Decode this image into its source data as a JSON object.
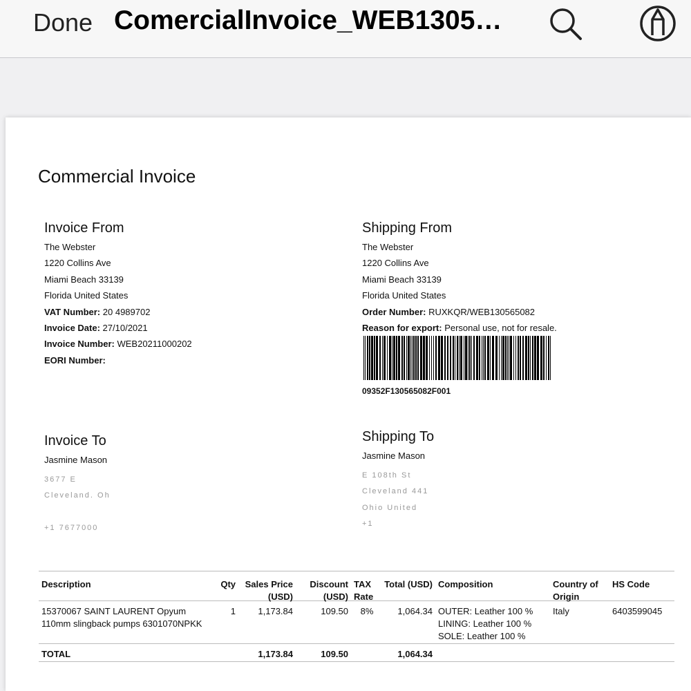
{
  "toolbar": {
    "done_label": "Done",
    "title": "ComercialInvoice_WEB1305…",
    "search_icon": "search-icon",
    "markup_icon": "markup-pen-icon"
  },
  "document": {
    "title": "Commercial Invoice",
    "invoice_from": {
      "heading": "Invoice From",
      "lines": [
        "The Webster",
        "1220 Collins Ave",
        "Miami Beach 33139",
        "Florida United States"
      ],
      "vat_label": "VAT Number:",
      "vat_value": "20 4989702",
      "date_label": "Invoice Date:",
      "date_value": "27/10/2021",
      "number_label": "Invoice Number:",
      "number_value": "WEB20211000202",
      "eori_label": "EORI Number:"
    },
    "shipping_from": {
      "heading": "Shipping From",
      "lines": [
        "The Webster",
        "1220 Collins Ave",
        "Miami Beach 33139",
        "Florida United States"
      ],
      "order_label": "Order Number:",
      "order_value": "RUXKQR/WEB130565082",
      "reason_label": "Reason for export:",
      "reason_value": "Personal use, not for resale.",
      "barcode_text": "09352F130565082F001"
    },
    "invoice_to": {
      "heading": "Invoice To",
      "name": "Jasmine Mason",
      "redacted_1": "3677 E",
      "redacted_2": "Cleveland, Oh",
      "redacted_3": "",
      "redacted_4": "+1 7677000"
    },
    "shipping_to": {
      "heading": "Shipping To",
      "name": "Jasmine Mason",
      "redacted_1": "E 108th St",
      "redacted_2": "Cleveland 441",
      "redacted_3": "Ohio United",
      "redacted_4": "+1"
    },
    "table": {
      "headers": {
        "description": "Description",
        "qty": "Qty",
        "sales_price": "Sales Price (USD)",
        "discount": "Discount (USD)",
        "tax_rate": "TAX Rate",
        "total": "Total (USD)",
        "composition": "Composition",
        "country": "Country of Origin",
        "hs_code": "HS Code"
      },
      "row": {
        "description": "15370067 SAINT LAURENT  Opyum 110mm slingback pumps 6301070NPKK",
        "qty": "1",
        "sales_price": "1,173.84",
        "discount": "109.50",
        "tax_rate": "8%",
        "total": "1,064.34",
        "composition_1": "OUTER: Leather 100 %",
        "composition_2": "LINING: Leather 100 %",
        "composition_3": "SOLE: Leather 100 %",
        "country": "Italy",
        "hs_code": "6403599045"
      },
      "totals": {
        "label": "TOTAL",
        "sales_price": "1,173.84",
        "discount": "109.50",
        "total": "1,064.34"
      }
    }
  }
}
